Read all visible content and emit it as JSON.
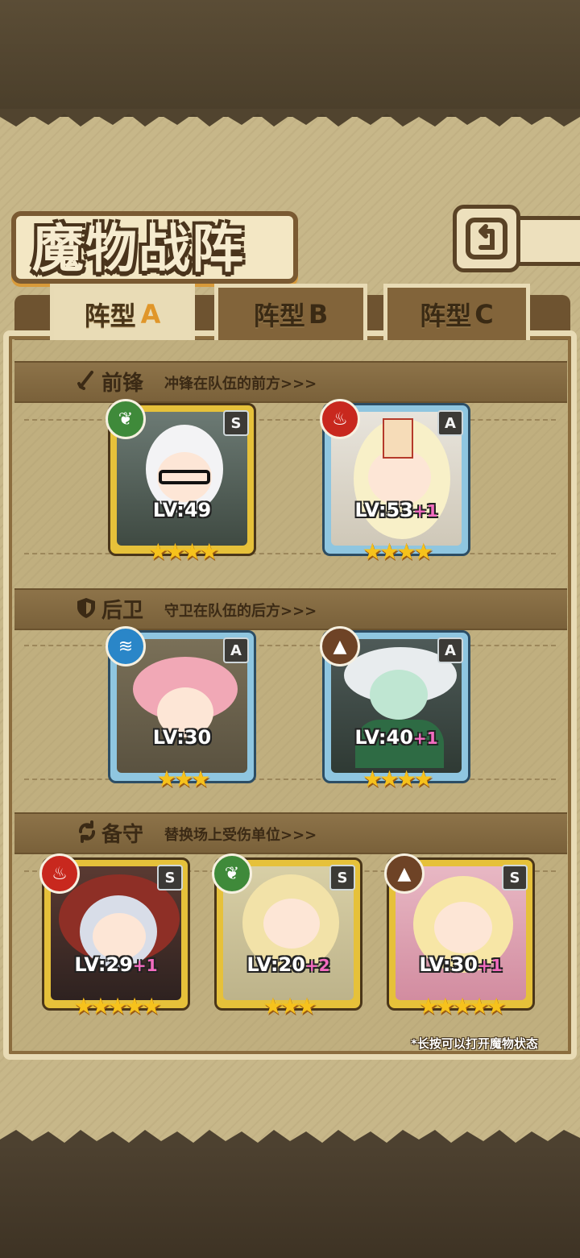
{
  "header": {
    "title": "魔物战阵"
  },
  "tabs": [
    {
      "label": "阵型",
      "letter": "A",
      "active": true
    },
    {
      "label": "阵型",
      "letter": "B",
      "active": false
    },
    {
      "label": "阵型",
      "letter": "C",
      "active": false
    }
  ],
  "sections": {
    "front": {
      "title": "前锋",
      "desc": "冲锋在队伍的前方>>>"
    },
    "back": {
      "title": "后卫",
      "desc": "守卫在队伍的后方>>>"
    },
    "reserve": {
      "title": "备守",
      "desc": "替换场上受伤单位>>>"
    }
  },
  "cards": [
    {
      "rank": "S",
      "element": "grass",
      "level": "LV:49",
      "bonus": "",
      "stars": 4
    },
    {
      "rank": "A",
      "element": "fire",
      "level": "LV:53",
      "bonus": "+1",
      "stars": 4
    },
    {
      "rank": "A",
      "element": "water",
      "level": "LV:30",
      "bonus": "",
      "stars": 3
    },
    {
      "rank": "A",
      "element": "earth",
      "level": "LV:40",
      "bonus": "+1",
      "stars": 4
    },
    {
      "rank": "S",
      "element": "fire",
      "level": "LV:29",
      "bonus": "+1",
      "stars": 5
    },
    {
      "rank": "S",
      "element": "grass",
      "level": "LV:20",
      "bonus": "+2",
      "stars": 3
    },
    {
      "rank": "S",
      "element": "earth",
      "level": "LV:30",
      "bonus": "+1",
      "stars": 5
    }
  ],
  "footnote": "*长按可以打开魔物状态",
  "colors": {
    "grass": "#3f8a3a",
    "fire": "#c8281e",
    "water": "#2a86c8",
    "earth": "#6e4326",
    "frame_gold": "#e6c13a",
    "frame_blue": "#8fc6e0",
    "star": "#f6c21c"
  }
}
